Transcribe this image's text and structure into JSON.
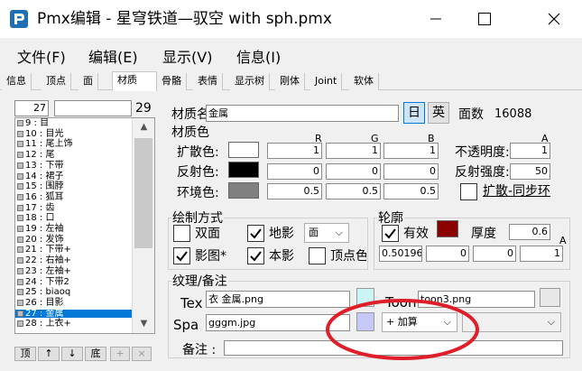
{
  "window": {
    "title": "Pmx编辑 - 星穹铁道—驭空 with sph.pmx",
    "minimize_glyph": "—",
    "maximize_glyph": "☐",
    "close_glyph": "✕"
  },
  "menu": [
    "文件(F)",
    "编辑(E)",
    "显示(V)",
    "信息(I)"
  ],
  "tabs": [
    "信息",
    "顶点",
    "面",
    "材质",
    "骨骼",
    "表情",
    "显示树",
    "刚体",
    "Joint",
    "软体"
  ],
  "active_tab": "材质",
  "left_panel": {
    "index_value": "27",
    "count": "29",
    "items": [
      "9 : 目",
      "10 : 目光",
      "11 : 尾上饰",
      "12 : 尾",
      "13 : 下带",
      "14 : 裙子",
      "15 : 围脖",
      "16 : 狐耳",
      "17 : 齿",
      "18 : 口",
      "19 : 左袖",
      "20 : 发饰",
      "21 : 下带+",
      "22 : 右袖+",
      "23 : 左袖+",
      "24 : 下带2",
      "25 : biaoq",
      "26 : 目影",
      "27 : 金属",
      "28 : 上衣+"
    ],
    "selected_index": 18,
    "bottom_buttons": [
      "顶",
      "↑",
      "↓",
      "底",
      "+",
      "×"
    ],
    "scroll_up": "▲",
    "scroll_down": "▼"
  },
  "material": {
    "name_label": "材质名",
    "name_value": "金属",
    "lang_jp": "日",
    "lang_en": "英",
    "count_label": "面数",
    "count_value": "16088",
    "color_group": "材质色",
    "rgb_headers": [
      "R",
      "G",
      "B"
    ],
    "alpha_header": "A",
    "diffuse_label": "扩散色:",
    "diffuse": [
      "1",
      "1",
      "1"
    ],
    "diffuse_color": "#ffffff",
    "specular_label": "反射色:",
    "specular": [
      "0",
      "0",
      "0"
    ],
    "specular_color": "#000000",
    "ambient_label": "环境色:",
    "ambient": [
      "0.5",
      "0.5",
      "0.5"
    ],
    "ambient_color": "#808080",
    "opacity_label": "不透明度:",
    "opacity_value": "1",
    "reflect_label": "反射强度:",
    "reflect_value": "50",
    "sync_label": "扩散-同步环"
  },
  "drawing": {
    "group": "绘制方式",
    "double_label": "双面",
    "double_checked": false,
    "ground_shadow_label": "地影",
    "ground_shadow_checked": true,
    "face_value": "面",
    "self_shadow_label": "影图*",
    "self_shadow_checked": true,
    "self_shadow2_label": "本影",
    "self_shadow2_checked": true,
    "vertex_label": "顶点色",
    "vertex_checked": false
  },
  "edge": {
    "group": "轮廓",
    "enabled_label": "有效",
    "enabled_checked": true,
    "color": "#8b0000",
    "size_label": "厚度",
    "size_value": "0.6",
    "alpha_header": "A",
    "rgba": [
      "0.501960",
      "0",
      "0",
      "1"
    ]
  },
  "texture": {
    "group": "纹理/备注",
    "tex_label": "Tex",
    "tex_value": "衣 金属.png",
    "tex_swatch": "#cdf4f4",
    "toon_label": "Toon",
    "toon_value": "toon3.png",
    "toon_swatch": "#e8e8e8",
    "spa_label": "Spa",
    "spa_value": "gggm.jpg",
    "spa_swatch": "#c8c8f8",
    "blend_value": "+ 加算",
    "memo_label": "备注 :",
    "memo_value": ""
  },
  "annotation_color": "#e01e2a"
}
